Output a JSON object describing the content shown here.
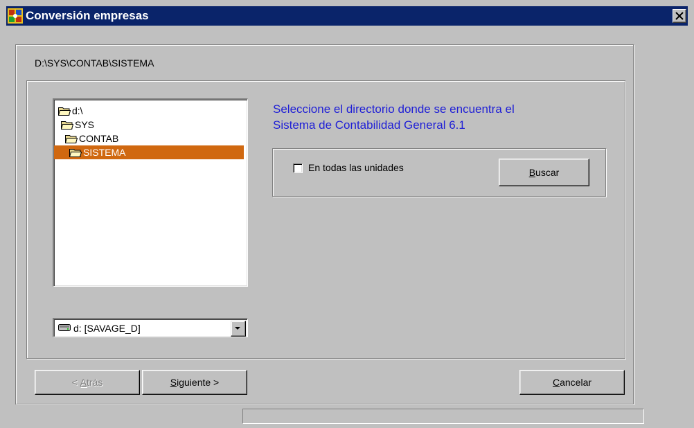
{
  "window": {
    "title": "Conversión empresas",
    "close_icon": "close-icon"
  },
  "path": "D:\\SYS\\CONTAB\\SISTEMA",
  "tree": {
    "items": [
      {
        "label": "d:\\",
        "icon": "folder-open-icon",
        "selected": false
      },
      {
        "label": "SYS",
        "icon": "folder-open-icon",
        "selected": false
      },
      {
        "label": "CONTAB",
        "icon": "folder-open-icon",
        "selected": false
      },
      {
        "label": "SISTEMA",
        "icon": "folder-open-icon",
        "selected": true
      }
    ]
  },
  "drive_select": {
    "value": "d: [SAVAGE_D]",
    "icon": "drive-icon"
  },
  "instruction": {
    "line1": "Seleccione el directorio donde se encuentra el",
    "line2": "Sistema de Contabilidad General 6.1"
  },
  "search": {
    "checkbox_label": "En todas las unidades",
    "checked": false,
    "button_mnemonic": "B",
    "button_rest": "uscar"
  },
  "nav": {
    "back": {
      "prefix": "< ",
      "mnemonic": "A",
      "rest": "trás",
      "enabled": false
    },
    "next": {
      "mnemonic": "S",
      "rest": "iguiente >",
      "enabled": true
    },
    "cancel": {
      "mnemonic": "C",
      "rest": "ancelar",
      "enabled": true
    }
  },
  "colors": {
    "titlebar": "#0a246a",
    "selection": "#d06810",
    "instruction_text": "#1f1fd6",
    "face": "#c0c0c0"
  }
}
